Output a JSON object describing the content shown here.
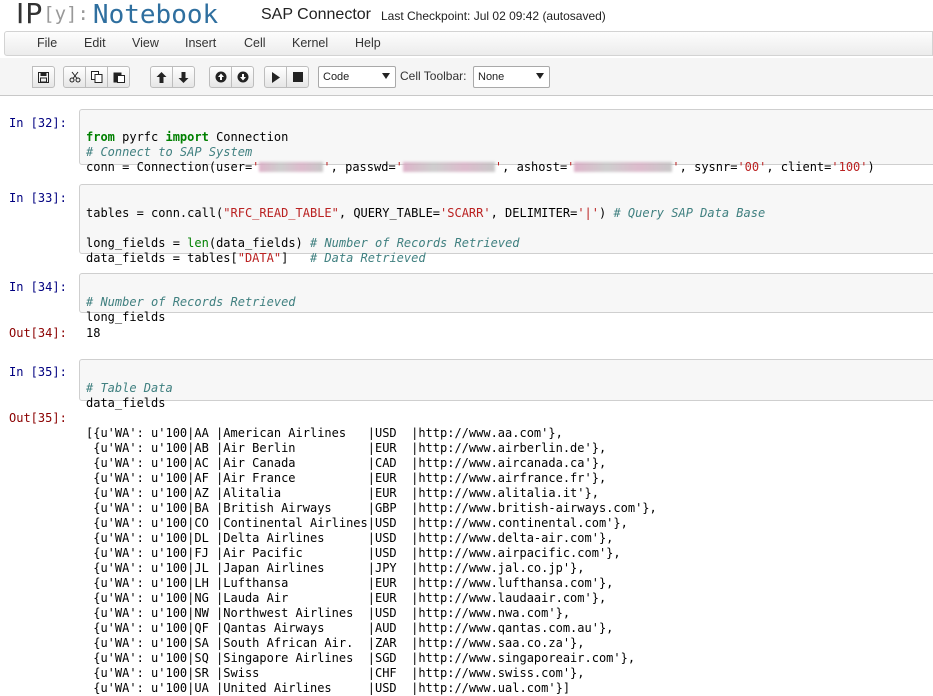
{
  "header": {
    "logo_ip": "IP",
    "logo_y": "[y]:",
    "logo_notebook": "Notebook",
    "notebook_name": "SAP Connector",
    "checkpoint": "Last Checkpoint: Jul 02 09:42 (autosaved)"
  },
  "menu": [
    "File",
    "Edit",
    "View",
    "Insert",
    "Cell",
    "Kernel",
    "Help"
  ],
  "toolbar": {
    "buttons": [
      "save-icon",
      "cut-icon",
      "copy-icon",
      "paste-icon",
      "move-up-icon",
      "move-down-icon",
      "insert-above-icon",
      "insert-below-icon",
      "run-icon",
      "stop-icon"
    ],
    "cell_type": "Code",
    "cell_toolbar_label": "Cell Toolbar:",
    "cell_toolbar_value": "None"
  },
  "cells": [
    {
      "prompt": "In [32]:",
      "lines": {
        "l1_kw1": "from",
        "l1_mod": " pyrfc ",
        "l1_kw2": "import",
        "l1_name": " Connection",
        "l2_comment": "# Connect to SAP System",
        "l3_a": "conn = Connection(user=",
        "l3_q1": "'",
        "l3_q1b": "'",
        "l3_b": ", passwd=",
        "l3_q2": "'",
        "l3_q2b": "'",
        "l3_c": ", ashost=",
        "l3_q3": "'",
        "l3_q3b": "'",
        "l3_d": ", sysnr=",
        "l3_sysnr": "'00'",
        "l3_e": ", client=",
        "l3_client": "'100'",
        "l3_f": ")"
      }
    },
    {
      "prompt": "In [33]:",
      "lines": {
        "l1_a": "tables = conn.call(",
        "l1_s1": "\"RFC_READ_TABLE\"",
        "l1_b": ", QUERY_TABLE=",
        "l1_s2": "'SCARR'",
        "l1_c": ", DELIMITER=",
        "l1_s3": "'|'",
        "l1_d": ") ",
        "l1_comment": "# Query SAP Data Base",
        "l3_a": "long_fields = ",
        "l3_len": "len",
        "l3_b": "(data_fields) ",
        "l3_comment": "# Number of Records Retrieved",
        "l4_a": "data_fields = tables[",
        "l4_s": "\"DATA\"",
        "l4_b": "]   ",
        "l4_comment": "# Data Retrieved"
      }
    },
    {
      "prompt": "In [34]:",
      "lines": {
        "l1_comment": "# Number of Records Retrieved",
        "l2": "long_fields"
      }
    },
    {
      "prompt": "Out[34]:",
      "output": "18"
    },
    {
      "prompt": "In [35]:",
      "lines": {
        "l1_comment": "# Table Data",
        "l2": "data_fields"
      }
    },
    {
      "prompt": "Out[35]:",
      "rows": [
        "[{u'WA': u'100|AA |American Airlines   |USD  |http://www.aa.com'},",
        " {u'WA': u'100|AB |Air Berlin          |EUR  |http://www.airberlin.de'},",
        " {u'WA': u'100|AC |Air Canada          |CAD  |http://www.aircanada.ca'},",
        " {u'WA': u'100|AF |Air France          |EUR  |http://www.airfrance.fr'},",
        " {u'WA': u'100|AZ |Alitalia            |EUR  |http://www.alitalia.it'},",
        " {u'WA': u'100|BA |British Airways     |GBP  |http://www.british-airways.com'},",
        " {u'WA': u'100|CO |Continental Airlines|USD  |http://www.continental.com'},",
        " {u'WA': u'100|DL |Delta Airlines      |USD  |http://www.delta-air.com'},",
        " {u'WA': u'100|FJ |Air Pacific         |USD  |http://www.airpacific.com'},",
        " {u'WA': u'100|JL |Japan Airlines      |JPY  |http://www.jal.co.jp'},",
        " {u'WA': u'100|LH |Lufthansa           |EUR  |http://www.lufthansa.com'},",
        " {u'WA': u'100|NG |Lauda Air           |EUR  |http://www.laudaair.com'},",
        " {u'WA': u'100|NW |Northwest Airlines  |USD  |http://www.nwa.com'},",
        " {u'WA': u'100|QF |Qantas Airways      |AUD  |http://www.qantas.com.au'},",
        " {u'WA': u'100|SA |South African Air.  |ZAR  |http://www.saa.co.za'},",
        " {u'WA': u'100|SQ |Singapore Airlines  |SGD  |http://www.singaporeair.com'},",
        " {u'WA': u'100|SR |Swiss               |CHF  |http://www.swiss.com'},",
        " {u'WA': u'100|UA |United Airlines     |USD  |http://www.ual.com'}]"
      ]
    }
  ]
}
